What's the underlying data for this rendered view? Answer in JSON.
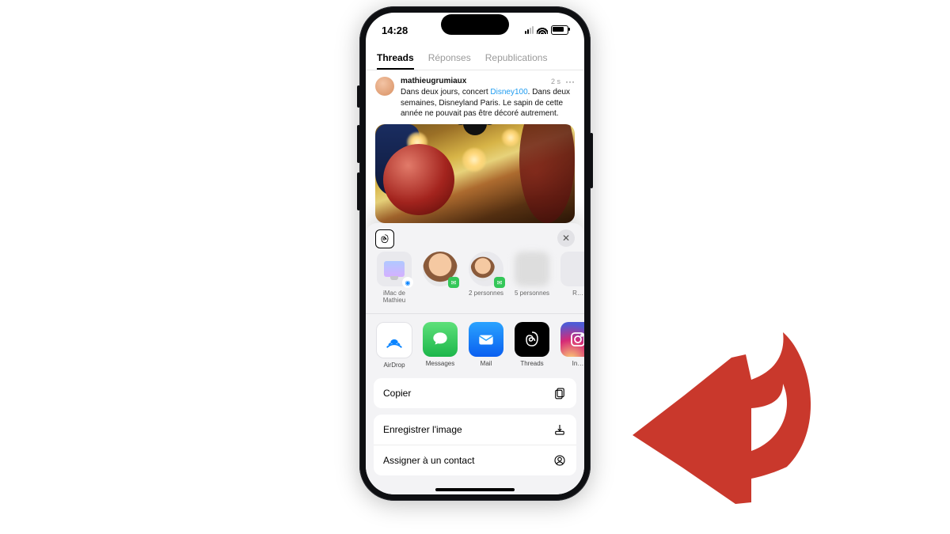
{
  "status": {
    "time": "14:28"
  },
  "tabs": [
    {
      "label": "Threads",
      "active": true
    },
    {
      "label": "Réponses",
      "active": false
    },
    {
      "label": "Republications",
      "active": false
    }
  ],
  "post": {
    "username": "mathieugrumiaux",
    "age": "2 s",
    "more": "···",
    "text_a": "Dans deux jours, concert ",
    "link": "Disney100",
    "text_b": ". Dans deux semaines, Disneyland Paris. Le sapin de cette année ne pouvait pas être décoré autrement."
  },
  "share": {
    "close": "✕",
    "targets": [
      {
        "label": "iMac de Mathieu",
        "kind": "airdrop"
      },
      {
        "label": "",
        "kind": "person"
      },
      {
        "label": "2 personnes",
        "kind": "person"
      },
      {
        "label": "5 personnes",
        "kind": "blur"
      },
      {
        "label": "R…",
        "kind": "blur"
      }
    ],
    "apps": [
      {
        "label": "AirDrop",
        "kind": "airdrop"
      },
      {
        "label": "Messages",
        "kind": "messages"
      },
      {
        "label": "Mail",
        "kind": "mail"
      },
      {
        "label": "Threads",
        "kind": "threads"
      },
      {
        "label": "In…",
        "kind": "insta"
      }
    ],
    "actions": {
      "copy": "Copier",
      "save_image": "Enregistrer l'image",
      "assign_contact": "Assigner à un contact"
    }
  }
}
